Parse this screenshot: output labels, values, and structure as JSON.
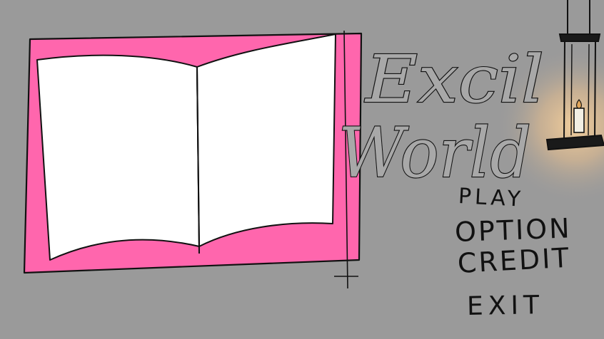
{
  "colors": {
    "background": "#9a9a9a",
    "book_frame": "#ff66ad",
    "book_page": "#ffffff",
    "lantern_glow": "#f4c58a",
    "outline": "#111111",
    "title_fill": "#a8a8a8"
  },
  "title": {
    "line1": "Excil",
    "line2": "World"
  },
  "menu": {
    "play": "PLAY",
    "option": "OPTION",
    "credit": "CREDIT",
    "exit": "EXIT"
  },
  "decor": {
    "book_icon": "open-book-icon",
    "lantern_icon": "hanging-lantern-icon"
  }
}
